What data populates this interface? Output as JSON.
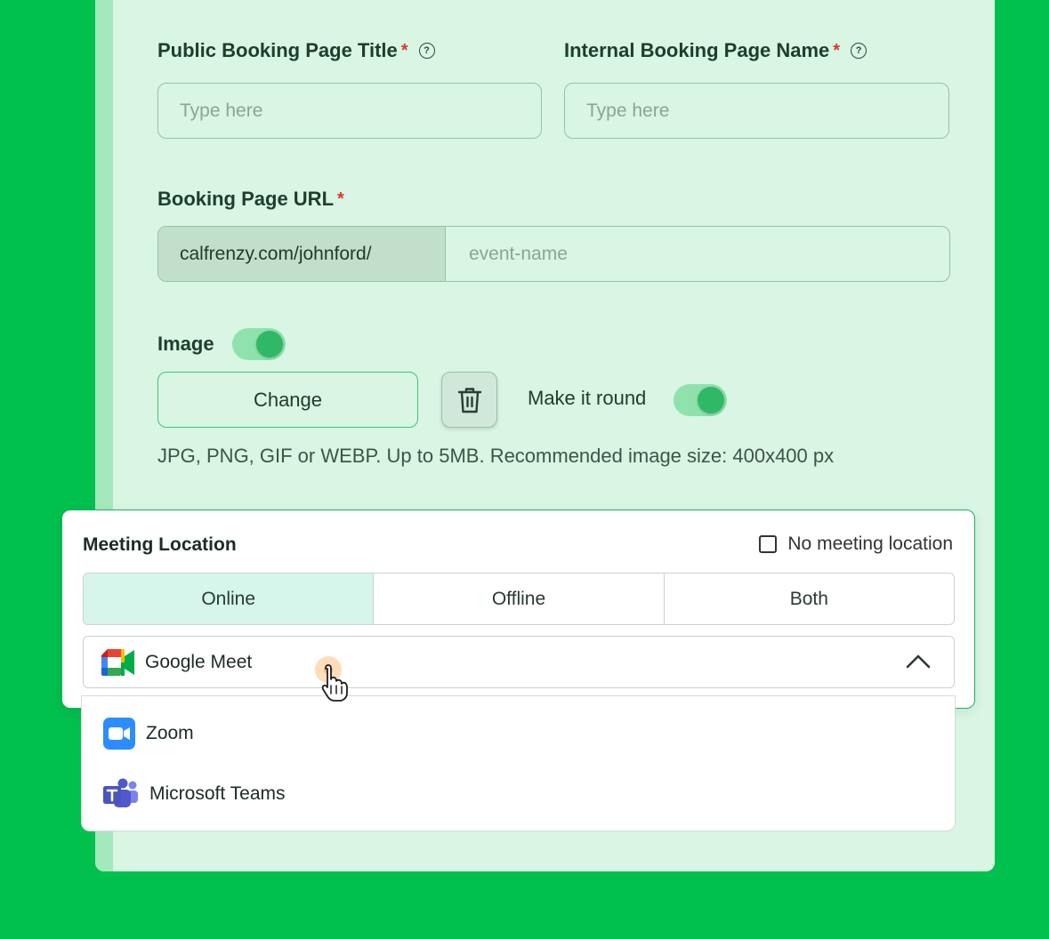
{
  "form": {
    "public_title_label": "Public Booking Page Title",
    "public_title_placeholder": "Type here",
    "internal_name_label": "Internal Booking Page Name",
    "internal_name_placeholder": "Type here",
    "required_mark": "*",
    "help_glyph": "?",
    "url_label": "Booking Page URL",
    "url_prefix": "calfrenzy.com/johnford/",
    "url_placeholder": "event-name",
    "image_label": "Image",
    "image_toggle_on": true,
    "change_button": "Change",
    "make_round_label": "Make it round",
    "make_round_on": true,
    "image_hint": "JPG, PNG, GIF or WEBP. Up to 5MB. Recommended image size: 400x400 px"
  },
  "meeting_location": {
    "title": "Meeting Location",
    "no_location_label": "No meeting location",
    "no_location_checked": false,
    "tabs": [
      {
        "label": "Online",
        "active": true
      },
      {
        "label": "Offline",
        "active": false
      },
      {
        "label": "Both",
        "active": false
      }
    ],
    "selected": "Google Meet",
    "options": [
      {
        "label": "Zoom",
        "icon": "zoom-icon"
      },
      {
        "label": "Microsoft Teams",
        "icon": "teams-icon"
      }
    ]
  },
  "colors": {
    "background": "#00c14e",
    "card": "#d9f5e4",
    "accent": "#2fb866",
    "required": "#d93b2b"
  }
}
